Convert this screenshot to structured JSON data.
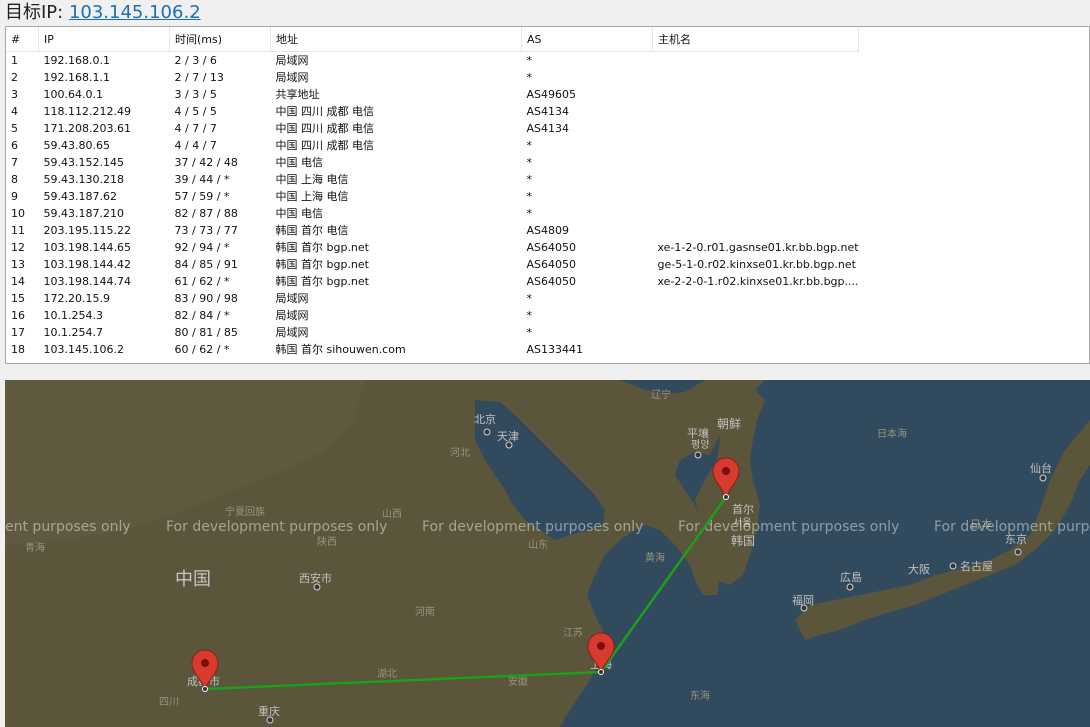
{
  "header": {
    "label": "目标IP: ",
    "ip": "103.145.106.2"
  },
  "table": {
    "columns": [
      "#",
      "IP",
      "时间(ms)",
      "地址",
      "AS",
      "主机名"
    ],
    "rows": [
      [
        "1",
        "192.168.0.1",
        "2 / 3 / 6",
        "局域网",
        "*",
        ""
      ],
      [
        "2",
        "192.168.1.1",
        "2 / 7 / 13",
        "局域网",
        "*",
        ""
      ],
      [
        "3",
        "100.64.0.1",
        "3 / 3 / 5",
        "共享地址",
        "AS49605",
        ""
      ],
      [
        "4",
        "118.112.212.49",
        "4 / 5 / 5",
        "中国 四川 成都 电信",
        "AS4134",
        ""
      ],
      [
        "5",
        "171.208.203.61",
        "4 / 7 / 7",
        "中国 四川 成都 电信",
        "AS4134",
        ""
      ],
      [
        "6",
        "59.43.80.65",
        "4 / 4 / 7",
        "中国 四川 成都 电信",
        "*",
        ""
      ],
      [
        "7",
        "59.43.152.145",
        "37 / 42 / 48",
        "中国 电信",
        "*",
        ""
      ],
      [
        "8",
        "59.43.130.218",
        "39 / 44 / *",
        "中国 上海 电信",
        "*",
        ""
      ],
      [
        "9",
        "59.43.187.62",
        "57 / 59 / *",
        "中国 上海 电信",
        "*",
        ""
      ],
      [
        "10",
        "59.43.187.210",
        "82 / 87 / 88",
        "中国 电信",
        "*",
        ""
      ],
      [
        "11",
        "203.195.115.22",
        "73 / 73 / 77",
        "韩国 首尔 电信",
        "AS4809",
        ""
      ],
      [
        "12",
        "103.198.144.65",
        "92 / 94 / *",
        "韩国 首尔 bgp.net",
        "AS64050",
        "xe-1-2-0.r01.gasnse01.kr.bb.bgp.net"
      ],
      [
        "13",
        "103.198.144.42",
        "84 / 85 / 91",
        "韩国 首尔 bgp.net",
        "AS64050",
        "ge-5-1-0.r02.kinxse01.kr.bb.bgp.net"
      ],
      [
        "14",
        "103.198.144.74",
        "61 / 62 / *",
        "韩国 首尔 bgp.net",
        "AS64050",
        "xe-2-2-0-1.r02.kinxse01.kr.bb.bgp...."
      ],
      [
        "15",
        "172.20.15.9",
        "83 / 90 / 98",
        "局域网",
        "*",
        ""
      ],
      [
        "16",
        "10.1.254.3",
        "82 / 84 / *",
        "局域网",
        "*",
        ""
      ],
      [
        "17",
        "10.1.254.7",
        "80 / 81 / 85",
        "局域网",
        "*",
        ""
      ],
      [
        "18",
        "103.145.106.2",
        "60 / 62 / *",
        "韩国 首尔 sihouwen.com",
        "AS133441",
        ""
      ]
    ]
  },
  "map": {
    "watermarks": [
      "ent purposes only",
      "For development purposes only",
      "For development purposes only",
      "For development purposes only",
      "For development purposes"
    ],
    "labels": {
      "china_big": "中国",
      "korea_north": "朝鲜",
      "korea_south": "韩国",
      "pyongyang": "平壤",
      "pyongyang_ko": "평양",
      "seoul": "首尔",
      "seoul_ko": "서울",
      "beijing": "北京",
      "tianjin": "天津",
      "hebei": "河北",
      "shanxi": "山西",
      "shaanxi": "陕西",
      "ningxia": "宁夏回族",
      "qinghai": "青海",
      "xian": "西安市",
      "henan": "河南",
      "hubei": "湖北",
      "anhui": "安徽",
      "jiangsu": "江苏",
      "shanghai": "上海",
      "shandong": "山东",
      "chengdu": "成都市",
      "sichuan": "四川",
      "chongqing": "重庆",
      "liaoning": "辽宁",
      "yellow_sea": "黄海",
      "east_sea": "东海",
      "japan_sea": "日本海",
      "sendai": "仙台",
      "tokyo": "东京",
      "nagoya": "名古屋",
      "osaka": "大阪",
      "hiroshima": "広島",
      "fukuoka": "福岡",
      "japan": "日本"
    },
    "route_color": "#1aa01a",
    "pin_color": "#d93a2e"
  }
}
